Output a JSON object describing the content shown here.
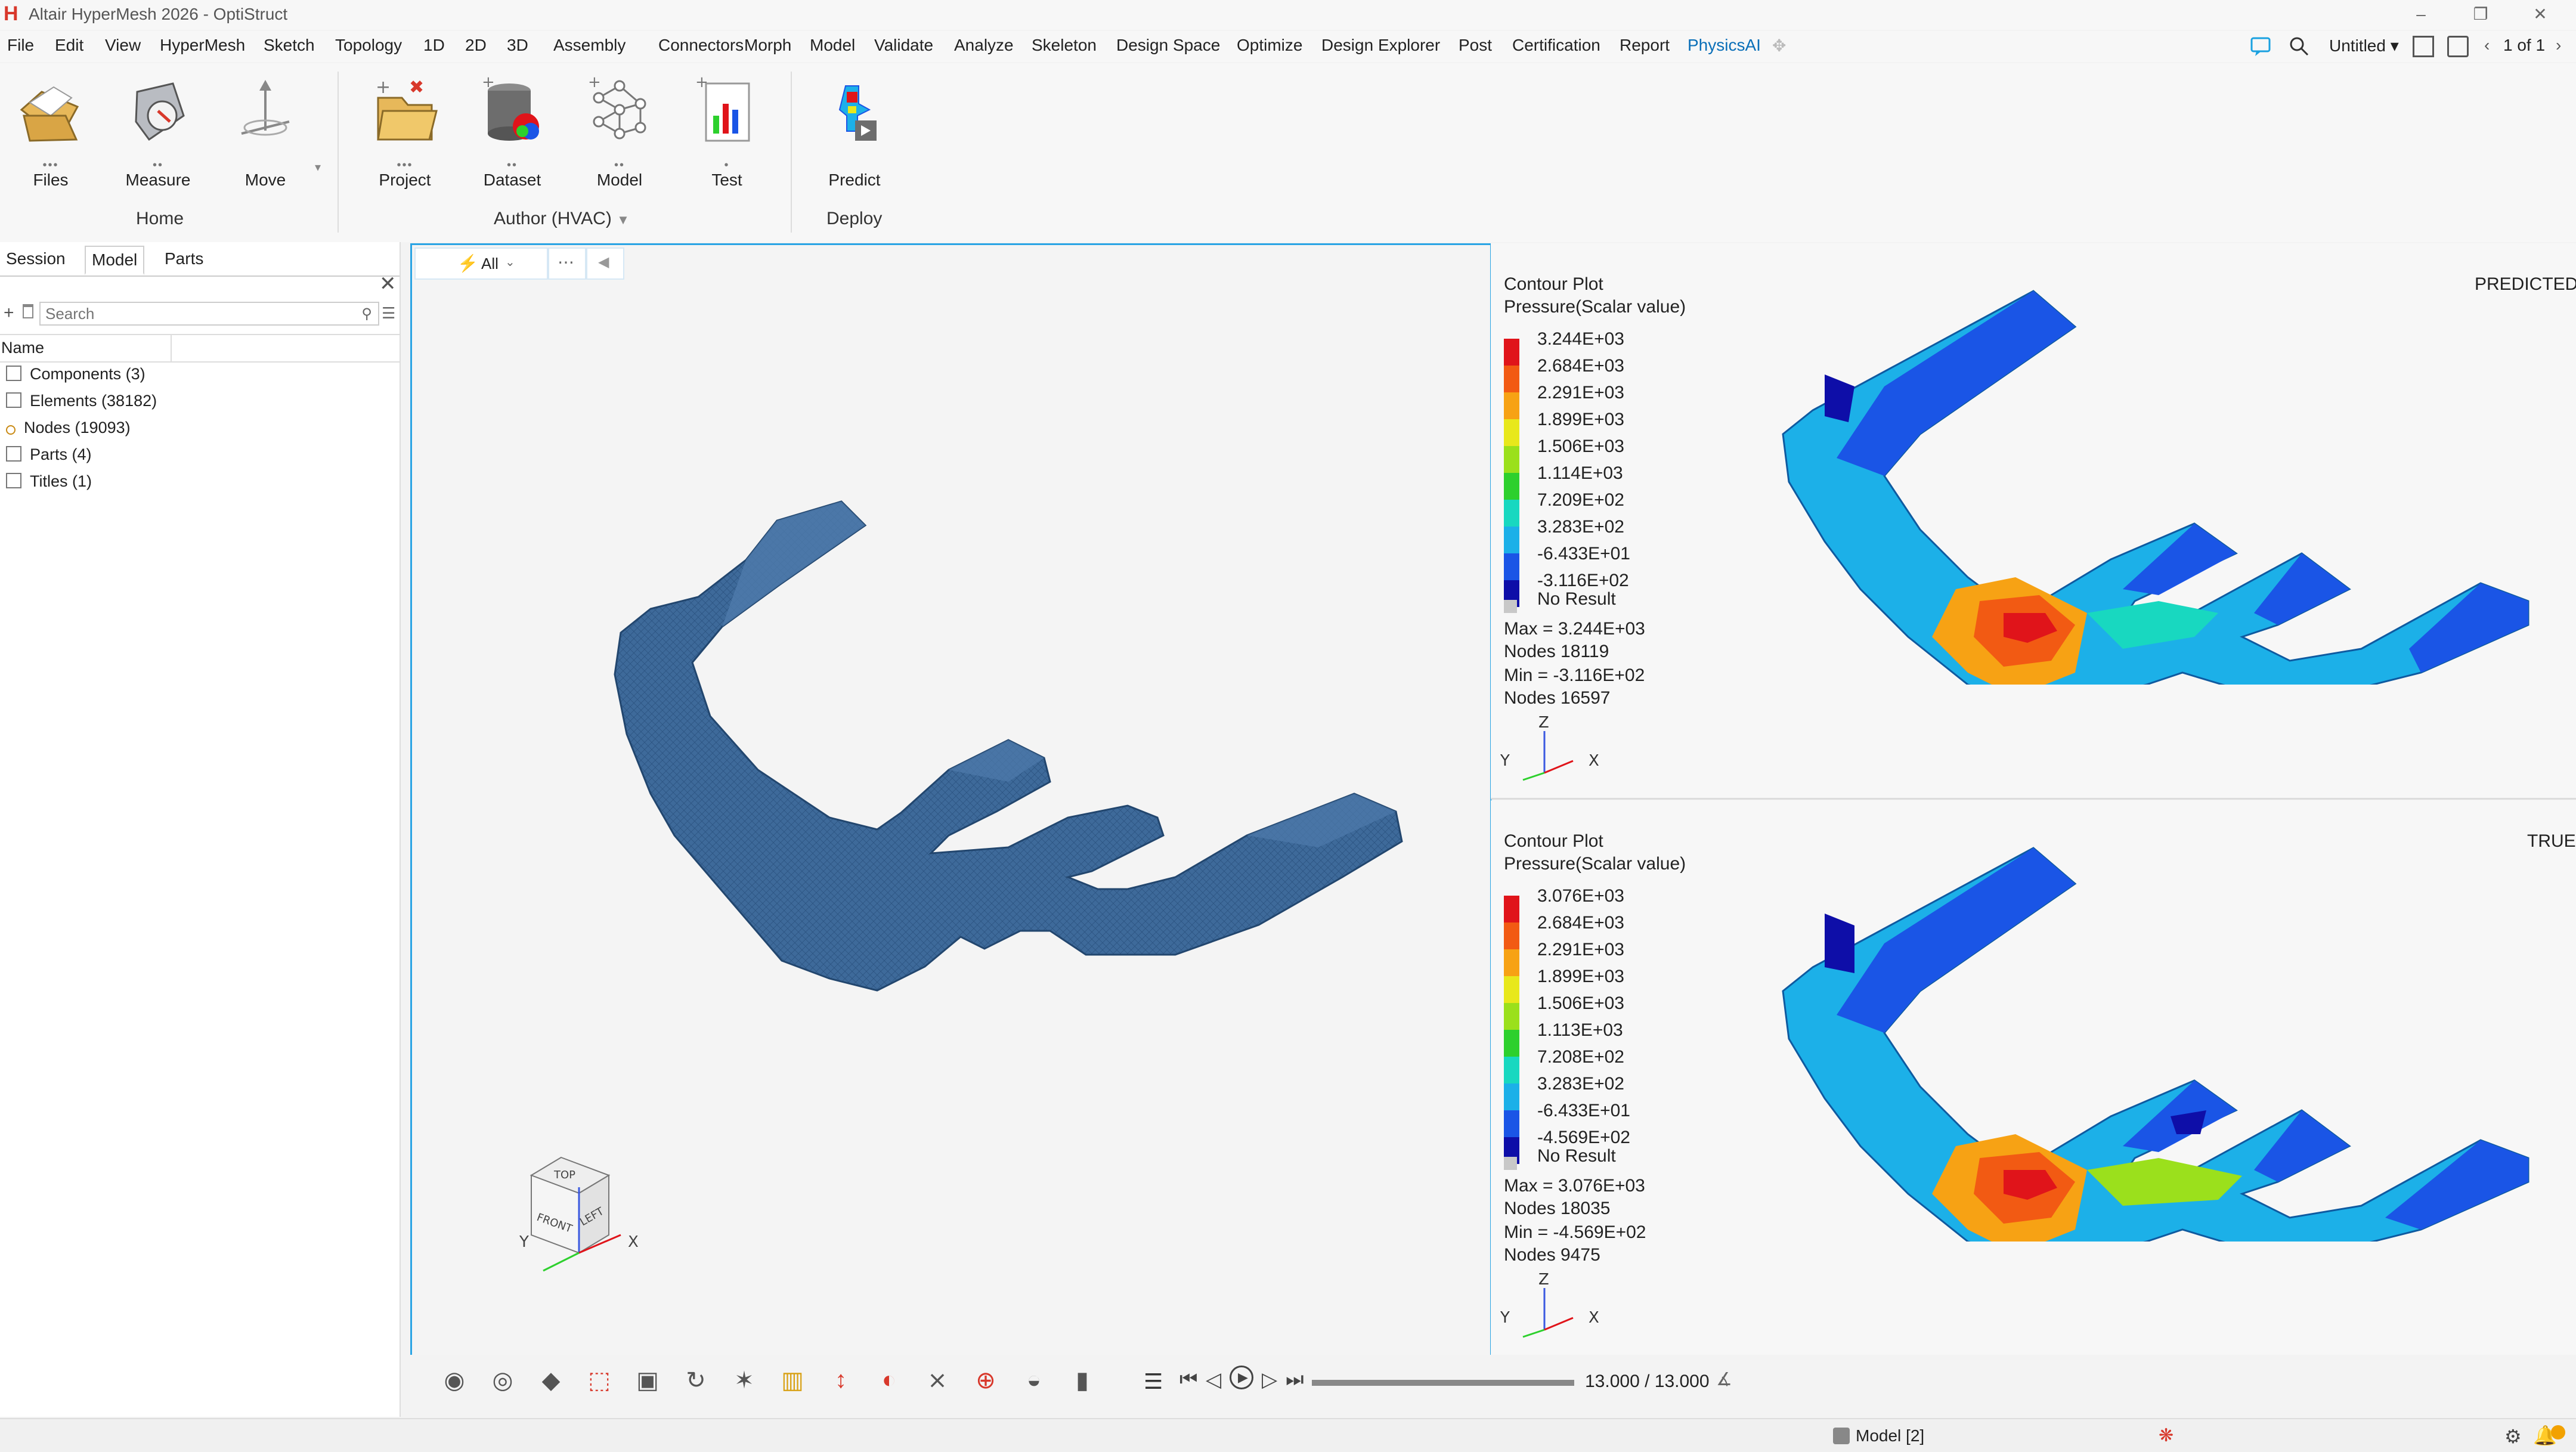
{
  "window": {
    "title": "Altair HyperMesh 2026 - OptiStruct"
  },
  "menu": {
    "items": [
      "File",
      "Edit",
      "View",
      "HyperMesh",
      "Sketch",
      "Topology",
      "1D",
      "2D",
      "3D",
      "Assembly",
      "Connectors",
      "Morph",
      "Model",
      "Validate",
      "Analyze",
      "Skeleton",
      "Design Space",
      "Optimize",
      "Design Explorer",
      "Post",
      "Certification",
      "Report",
      "PhysicsAI"
    ],
    "active": "PhysicsAI",
    "right": {
      "untitled_label": "Untitled",
      "pager": "1 of 1"
    }
  },
  "ribbon": {
    "tools": [
      {
        "label": "Files",
        "icon": "folder-files-icon"
      },
      {
        "label": "Measure",
        "icon": "measure-icon"
      },
      {
        "label": "Move",
        "icon": "move-icon"
      },
      {
        "label": "Project",
        "icon": "project-folder-icon"
      },
      {
        "label": "Dataset",
        "icon": "dataset-icon"
      },
      {
        "label": "Model",
        "icon": "model-network-icon"
      },
      {
        "label": "Test",
        "icon": "test-chart-icon"
      },
      {
        "label": "Predict",
        "icon": "predict-icon"
      }
    ],
    "groups": {
      "home": "Home",
      "author": "Author (HVAC)",
      "deploy": "Deploy"
    }
  },
  "left_panel": {
    "tabs": [
      "Session",
      "Model",
      "Parts"
    ],
    "active_tab": "Model",
    "search_placeholder": "Search",
    "column_header": "Name",
    "tree": [
      "Components (3)",
      "Elements (38182)",
      "Nodes (19093)",
      "Parts (4)",
      "Titles (1)"
    ]
  },
  "viewport": {
    "filter_label": "All",
    "more_label": "⋯",
    "cube_faces": {
      "top": "TOP",
      "front": "FRONT",
      "left": "LEFT"
    },
    "axes": {
      "y": "Y",
      "x": "X"
    }
  },
  "predicted": {
    "header": "PREDICTED",
    "title": "Contour Plot",
    "subtitle": "Pressure(Scalar value)",
    "legend": [
      "3.244E+03",
      "2.684E+03",
      "2.291E+03",
      "1.899E+03",
      "1.506E+03",
      "1.114E+03",
      "7.209E+02",
      "3.283E+02",
      "-6.433E+01",
      "-3.116E+02"
    ],
    "no_result": "No Result",
    "max": "Max = 3.244E+03",
    "max_nodes": "Nodes 18119",
    "min": "Min = -3.116E+02",
    "min_nodes": "Nodes 16597",
    "triad": {
      "z": "Z",
      "y": "Y",
      "x": "X"
    }
  },
  "true_result": {
    "header": "TRUE",
    "title": "Contour Plot",
    "subtitle": "Pressure(Scalar value)",
    "legend": [
      "3.076E+03",
      "2.684E+03",
      "2.291E+03",
      "1.899E+03",
      "1.506E+03",
      "1.113E+03",
      "7.208E+02",
      "3.283E+02",
      "-6.433E+01",
      "-4.569E+02"
    ],
    "no_result": "No Result",
    "max": "Max = 3.076E+03",
    "max_nodes": "Nodes 18035",
    "min": "Min = -4.569E+02",
    "min_nodes": "Nodes 9475",
    "triad": {
      "z": "Z",
      "y": "Y",
      "x": "X"
    }
  },
  "legend_colors": [
    "#e0141a",
    "#f25a13",
    "#f7a214",
    "#e8e81c",
    "#9be01c",
    "#2dd02d",
    "#18d8c0",
    "#1cb0e8",
    "#1a55e6",
    "#0e0ea8"
  ],
  "animation": {
    "time": "13.000 / 13.000",
    "progress": 1.0
  },
  "status": {
    "model_label": "Model [2]"
  }
}
